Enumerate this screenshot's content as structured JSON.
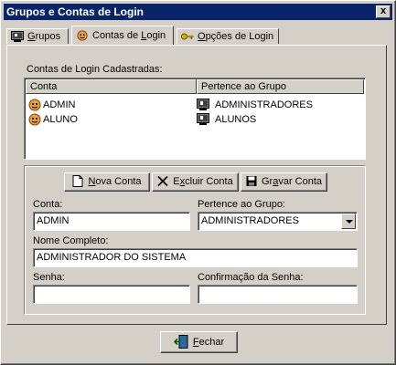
{
  "window": {
    "title": "Grupos e Contas de Login",
    "close_label": "x"
  },
  "tabs": [
    {
      "label": "Grupos",
      "underline": "G",
      "rest": "rupos"
    },
    {
      "label": "Contas de Login",
      "before": "Contas de ",
      "underline": "L",
      "rest": "ogin"
    },
    {
      "label": "Opções de Login",
      "underline": "O",
      "rest": "pções de Login"
    }
  ],
  "accounts_list": {
    "label": "Contas de Login Cadastradas:",
    "columns": [
      "Conta",
      "Pertence ao Grupo"
    ],
    "rows": [
      {
        "account": "ADMIN",
        "group": "ADMINISTRADORES"
      },
      {
        "account": "ALUNO",
        "group": "ALUNOS"
      }
    ]
  },
  "toolbar": {
    "new": {
      "underline": "N",
      "rest": "ova Conta"
    },
    "delete": {
      "before": "E",
      "underline": "x",
      "rest": "cluir Conta"
    },
    "save": {
      "before": "Gr",
      "underline": "a",
      "rest": "var Conta"
    }
  },
  "form": {
    "account_label": "Conta:",
    "account_value": "ADMIN",
    "group_label": "Pertence ao Grupo:",
    "group_value": "ADMINISTRADORES",
    "fullname_label": "Nome Completo:",
    "fullname_value": "ADMINISTRADOR DO SISTEMA",
    "password_label": "Senha:",
    "password_value": "",
    "confirm_label": "Confirmação da Senha:",
    "confirm_value": ""
  },
  "footer": {
    "close": {
      "underline": "F",
      "rest": "echar"
    }
  },
  "icons": {
    "group_tab": "monitor-group-icon",
    "accounts_tab": "user-face-icon",
    "options_tab": "key-icon",
    "new": "new-document-icon",
    "delete": "x-icon",
    "save": "floppy-disk-icon",
    "close": "exit-door-icon"
  },
  "colors": {
    "titlebar": "#0a246a",
    "face": "#d4d0c8"
  }
}
